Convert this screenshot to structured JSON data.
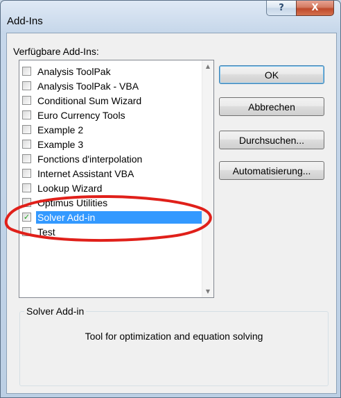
{
  "window": {
    "title": "Add-Ins",
    "help_glyph": "?",
    "close_glyph": "X"
  },
  "list": {
    "label": "Verfügbare Add-Ins:",
    "items": [
      {
        "label": "Analysis ToolPak",
        "checked": false,
        "selected": false
      },
      {
        "label": "Analysis ToolPak - VBA",
        "checked": false,
        "selected": false
      },
      {
        "label": "Conditional Sum Wizard",
        "checked": false,
        "selected": false
      },
      {
        "label": "Euro Currency Tools",
        "checked": false,
        "selected": false
      },
      {
        "label": "Example 2",
        "checked": false,
        "selected": false
      },
      {
        "label": "Example 3",
        "checked": false,
        "selected": false
      },
      {
        "label": "Fonctions d'interpolation",
        "checked": false,
        "selected": false
      },
      {
        "label": "Internet Assistant VBA",
        "checked": false,
        "selected": false
      },
      {
        "label": "Lookup Wizard",
        "checked": false,
        "selected": false
      },
      {
        "label": "Optimus Utilities",
        "checked": false,
        "selected": false
      },
      {
        "label": "Solver Add-in",
        "checked": true,
        "selected": true
      },
      {
        "label": "Test",
        "checked": false,
        "selected": false
      }
    ],
    "checkmark": "✓",
    "scroll_up": "▲",
    "scroll_down": "▼"
  },
  "buttons": {
    "ok": "OK",
    "cancel": "Abbrechen",
    "browse": "Durchsuchen...",
    "automation": "Automatisierung..."
  },
  "description": {
    "title": "Solver Add-in",
    "text": "Tool for optimization and equation solving"
  },
  "colors": {
    "selection": "#3399ff",
    "annotation": "#e0201a",
    "close_button": "#c9502f"
  },
  "annotation": {
    "type": "red-ellipse",
    "target": "Solver Add-in"
  }
}
